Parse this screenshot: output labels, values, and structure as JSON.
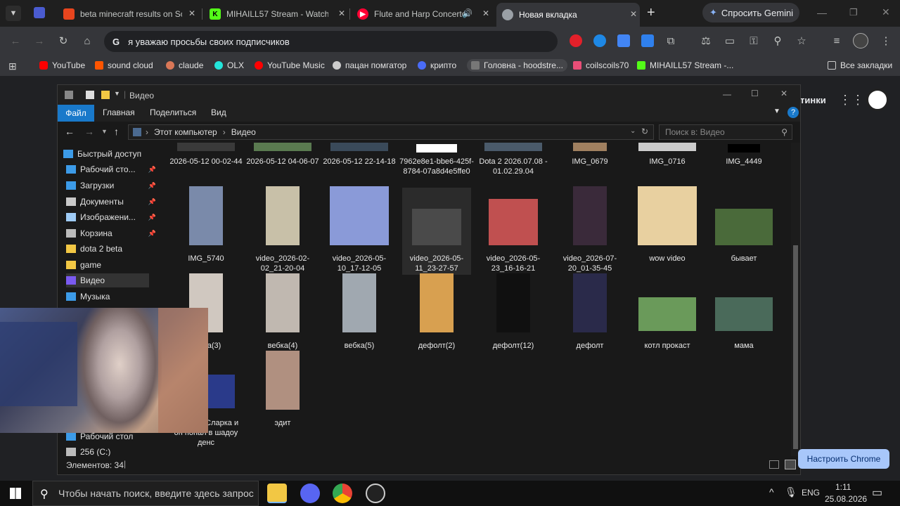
{
  "chrome": {
    "tabs": [
      {
        "title": "beta minecraft results on Sc",
        "favicon_color": "#e8451e",
        "active": false
      },
      {
        "title": "MIHAILL57 Stream - Watch I",
        "favicon_color": "#53fc18",
        "active": false
      },
      {
        "title": "Flute and Harp Concerto",
        "favicon_color": "#ff0033",
        "active": false
      },
      {
        "title": "Новая вкладка",
        "favicon_color": "#9aa0a6",
        "active": true
      }
    ],
    "new_tab": "+",
    "gemini_label": "Спросить Gemini",
    "omnibox_text": "я уважаю просьбы своих подписчиков",
    "bookmarks": [
      {
        "label": "YouTube",
        "color": "#ff0000"
      },
      {
        "label": "sound cloud",
        "color": "#ff5500"
      },
      {
        "label": "claude",
        "color": "#d97757"
      },
      {
        "label": "OLX",
        "color": "#23e5db"
      },
      {
        "label": "YouTube Music",
        "color": "#ff0000"
      },
      {
        "label": "пацан помгатор",
        "color": "#cccccc"
      },
      {
        "label": "крипто",
        "color": "#4a6cf7"
      },
      {
        "label": "Головна - hoodstre...",
        "color": "#555555"
      },
      {
        "label": "coilscoils70",
        "color": "#e94e77"
      },
      {
        "label": "MIHAILL57 Stream -...",
        "color": "#53fc18"
      }
    ],
    "all_bookmarks": "Все закладки",
    "page_partial_text": "тинки",
    "customize_button": "Настроить Chrome"
  },
  "explorer": {
    "title": "Видео",
    "ribbon": [
      "Файл",
      "Главная",
      "Поделиться",
      "Вид"
    ],
    "breadcrumb": [
      "Этот компьютер",
      "Видео"
    ],
    "search_placeholder": "Поиск в: Видео",
    "nav": [
      {
        "label": "Быстрый доступ",
        "color": "#3c9be8",
        "pinned": false
      },
      {
        "label": "Рабочий сто...",
        "color": "#3c9be8",
        "pinned": true
      },
      {
        "label": "Загрузки",
        "color": "#3c9be8",
        "pinned": true
      },
      {
        "label": "Документы",
        "color": "#c9c9c9",
        "pinned": true
      },
      {
        "label": "Изображени...",
        "color": "#9ecbf5",
        "pinned": true
      },
      {
        "label": "Корзина",
        "color": "#bbbbbb",
        "pinned": true
      },
      {
        "label": "dota 2 beta",
        "color": "#f2c744",
        "pinned": false
      },
      {
        "label": "game",
        "color": "#f2c744",
        "pinned": false
      },
      {
        "label": "Видео",
        "color": "#7a5af0",
        "pinned": false
      },
      {
        "label": "Музыка",
        "color": "#3c9be8",
        "pinned": false
      }
    ],
    "nav_bottom": [
      {
        "label": "Рабочий стол",
        "color": "#3c9be8"
      },
      {
        "label": "256 (C:)",
        "color": "#bbbbbb"
      }
    ],
    "rows": [
      [
        "2026-05-12 00-02-44",
        "2026-05-12 04-06-07",
        "2026-05-12 22-14-18",
        "7962e8e1-bbe6-425f-8784-07a8d4e5ffe0",
        "Dota 2 2026.07.08 - 01.02.29.04",
        "IMG_0679",
        "IMG_0716",
        "IMG_4449"
      ],
      [
        "IMG_5740",
        "video_2026-02-02_21-20-04",
        "video_2026-05-10_17-12-05",
        "video_2026-05-11_23-27-57",
        "video_2026-05-23_16-16-21",
        "video_2026-07-20_01-35-45",
        "wow video",
        "бывает"
      ],
      [
        "вебка(3)",
        "вебка(4)",
        "вебка(5)",
        "дефолт(2)",
        "дефолт(12)",
        "дефолт",
        "котл прокаст",
        "мама"
      ],
      [
        "он лул в Сларка и он попал в шадоу денс",
        "эдит"
      ]
    ],
    "status": "Элементов: 34"
  },
  "taskbar": {
    "search_placeholder": "Чтобы начать поиск, введите здесь запрос",
    "lang": "ENG",
    "time": "1:11",
    "date": "25.08.2026"
  }
}
